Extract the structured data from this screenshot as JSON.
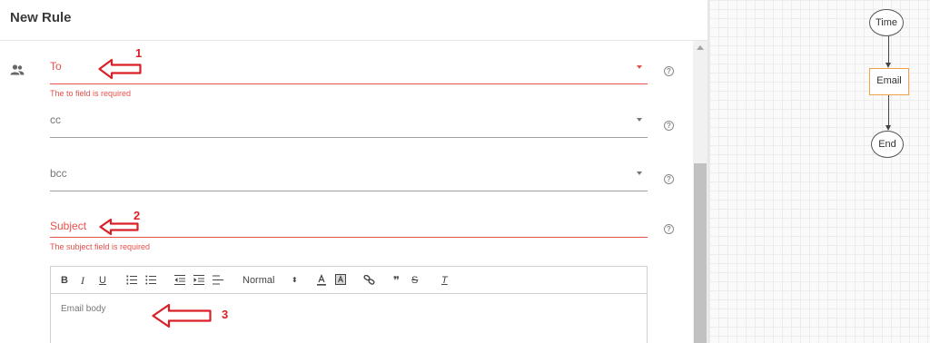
{
  "header": {
    "title": "New Rule"
  },
  "form": {
    "to": {
      "label": "To",
      "error": "The to field is required",
      "help": "?"
    },
    "cc": {
      "label": "cc",
      "help": "?"
    },
    "bcc": {
      "label": "bcc",
      "help": "?"
    },
    "subject": {
      "label": "Subject",
      "error": "The subject field is required",
      "help": "?"
    }
  },
  "editor": {
    "toolbar": {
      "bold": "B",
      "italic": "I",
      "underline": "U",
      "size": "Normal",
      "size_arrows": "⬍",
      "quote": "❞",
      "strike": "S",
      "clear": "T"
    },
    "placeholder": "Email body"
  },
  "annotations": [
    "1",
    "2",
    "3"
  ],
  "flow": {
    "nodes": [
      "Time",
      "Email",
      "End"
    ]
  },
  "colors": {
    "error": "#e8504a",
    "annotation": "#d92027",
    "email_node_border": "#f0a24a"
  },
  "icons": {
    "people": "people-icon",
    "help": "help-circle-icon",
    "dropdown": "caret-down-icon"
  }
}
